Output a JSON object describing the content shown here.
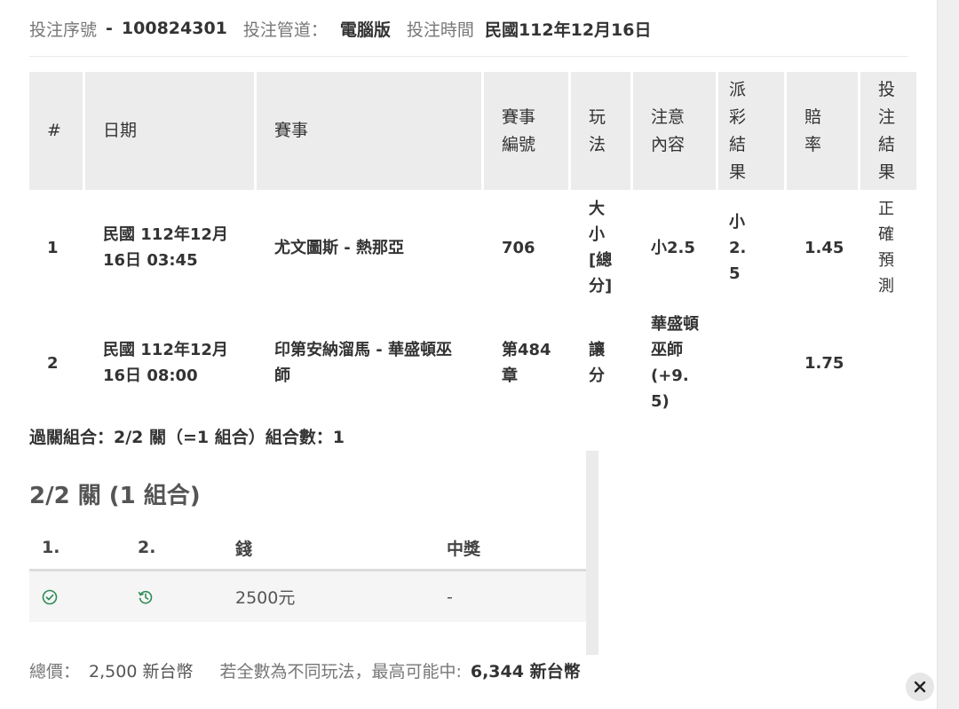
{
  "header": {
    "bet_no_label": "投注序號",
    "bet_no_sep": "-",
    "bet_no": "100824301",
    "channel_label": "投注管道：",
    "channel": "電腦版",
    "time_label": "投注時間",
    "time": "民國112年12月16日"
  },
  "table": {
    "headers": {
      "num": "#",
      "date": "日期",
      "match": "賽事",
      "match_no": "賽事編號",
      "play": "玩法",
      "selection": "注意內容",
      "result": "派彩結果",
      "odds": "賠率",
      "bet_result": "投注結果"
    },
    "rows": [
      {
        "num": "1",
        "date": "民國 112年12月16日 03:45",
        "match": "尤文圖斯 - 熱那亞",
        "match_no": "706",
        "play": "大小[總分]",
        "selection": "小2.5",
        "result": "小 2.5",
        "odds": "1.45",
        "bet_result": "正確預測"
      },
      {
        "num": "2",
        "date": "民國 112年12月16日 08:00",
        "match": "印第安納溜馬 - 華盛頓巫師",
        "match_no": "第484章",
        "play": "讓分",
        "selection": "華盛頓巫師(+9.5)",
        "result": "",
        "odds": "1.75",
        "bet_result": ""
      }
    ]
  },
  "parlay_summary": "過關組合：2/2 關（=1 組合）組合數：1",
  "combo": {
    "title": "2/2 關 (1 組合)",
    "headers": {
      "c1": "1.",
      "c2": "2.",
      "money": "錢",
      "prize": "中獎"
    },
    "row": {
      "icon1": "check-circle-icon",
      "icon2": "clock-history-icon",
      "money": "2500元",
      "prize": "-"
    },
    "colors": {
      "icon_green": "#2e8b57"
    }
  },
  "total": {
    "label": "總價：",
    "value": "2,500 新台幣",
    "max_label": "若全數為不同玩法，最高可能中:",
    "max_value": "6,344 新台幣"
  },
  "close_icon": "close-icon"
}
